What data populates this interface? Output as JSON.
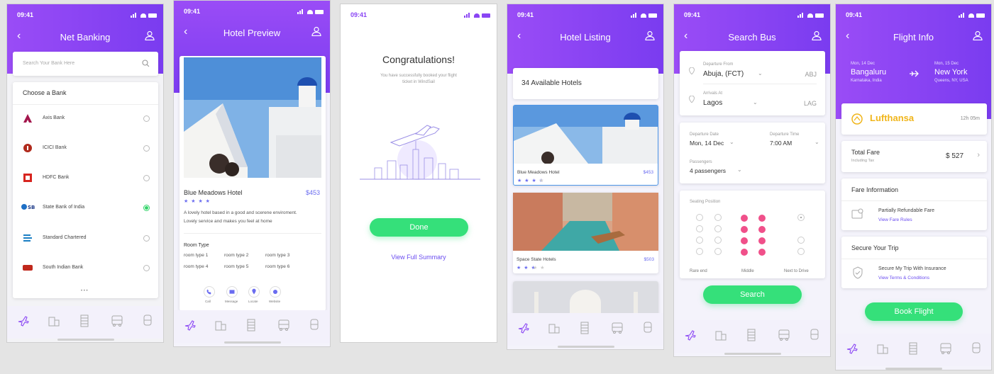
{
  "status_time": "09:41",
  "colors": {
    "accent": "#8a45f4",
    "green": "#35e07a",
    "pink": "#f0508a",
    "link": "#6a4cf0"
  },
  "tabs": [
    "plane-icon",
    "building-icon",
    "film-icon",
    "bus-icon",
    "train-icon"
  ],
  "net_banking": {
    "title": "Net Banking",
    "search_placeholder": "Search Your Bank Here",
    "choose_label": "Choose a Bank",
    "banks": [
      {
        "name": "Axis Bank",
        "selected": false
      },
      {
        "name": "ICICI Bank",
        "selected": false
      },
      {
        "name": "HDFC Bank",
        "selected": false
      },
      {
        "name": "State Bank of India",
        "selected": true
      },
      {
        "name": "Standard Chartered",
        "selected": false
      },
      {
        "name": "South Indian Bank",
        "selected": false
      }
    ],
    "more": "• • •"
  },
  "hotel_preview": {
    "title": "Hotel Preview",
    "hotel_name": "Blue Meadows Hotel",
    "price": "$453",
    "stars": "★ ★ ★ ★",
    "desc_line1": "A lovely hotel based in a good and scerene enviroment.",
    "desc_line2": "Lovely service and makes you feel at home",
    "room_type_label": "Room Type",
    "rooms": [
      "room type 1",
      "room type 2",
      "room type 3",
      "room type 4",
      "room type 5",
      "room type 6"
    ],
    "actions": [
      "Call",
      "Message",
      "Locate",
      "Website"
    ]
  },
  "congrats": {
    "title": "Congratulations!",
    "msg_line1": "You have successfully booked your flight",
    "msg_line2": "ticket in WindSail",
    "done": "Done",
    "summary": "View Full Summary"
  },
  "hotel_listing": {
    "title": "Hotel Listing",
    "count": "34 Available Hotels",
    "hotels": [
      {
        "name": "Blue Meadows Hotel",
        "price": "$453",
        "stars": "★ ★ ★ ★",
        "empty": " ★"
      },
      {
        "name": "Space State Hotels",
        "price": "$503",
        "stars": "★ ★ ★",
        "empty": " ★ ★"
      }
    ]
  },
  "search_bus": {
    "title": "Search Bus",
    "from_label": "Departure From",
    "from_city": "Abuja, (FCT)",
    "from_code": "ABJ",
    "to_label": "Arrivals At",
    "to_city": "Lagos",
    "to_code": "LAG",
    "date_label": "Departure Date",
    "date_value": "Mon, 14 Dec",
    "time_label": "Departure Time",
    "time_value": "7:00 AM",
    "pass_label": "Passengers",
    "pass_value": "4 passengers",
    "seat_label": "Seating Position",
    "seat_zones": [
      "Rare end",
      "Middle",
      "Next to Drive"
    ],
    "search": "Search"
  },
  "flight_info": {
    "title": "Flight Info",
    "dep_date": "Mon, 14 Dec",
    "dep_city": "Bangaluru",
    "dep_state": "Karnataka, India",
    "arr_date": "Mon, 15 Dec",
    "arr_city": "New York",
    "arr_state": "Queens, NY, USA",
    "airline": "Lufthansa",
    "duration": "12h 05m",
    "total_label": "Total Fare",
    "total_sub": "Including Tax",
    "total_value": "$ 527",
    "fare_info": "Fare Information",
    "fare_refund": "Partially Refundable Fare",
    "fare_rules": "View Fare Rules",
    "secure_title": "Secure Your Trip",
    "secure_text": "Secure My Trip With Insurance",
    "secure_link": "View Terms & Conditions",
    "book": "Book Flight"
  }
}
